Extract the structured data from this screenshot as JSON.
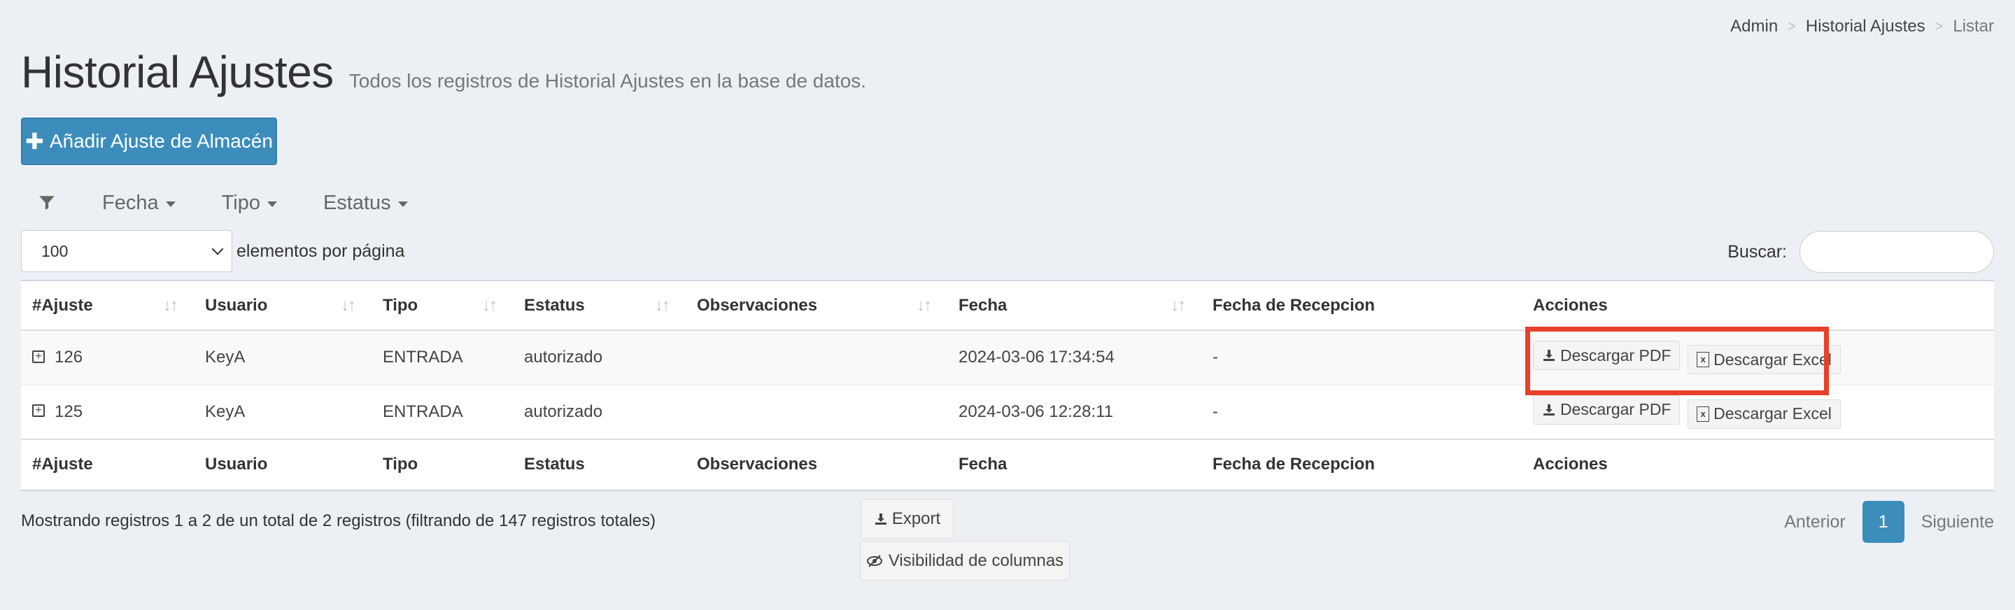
{
  "breadcrumb": {
    "items": [
      "Admin",
      "Historial Ajustes",
      "Listar"
    ],
    "separator": ">"
  },
  "header": {
    "title": "Historial Ajustes",
    "subtitle": "Todos los registros de Historial Ajustes en la base de datos."
  },
  "add_button": {
    "label": "Añadir Ajuste de Almacén",
    "icon": "plus-icon"
  },
  "filters": {
    "icon": "filter-icon",
    "items": [
      "Fecha",
      "Tipo",
      "Estatus"
    ]
  },
  "length": {
    "value": "100",
    "label": "elementos por página"
  },
  "search": {
    "label": "Buscar:",
    "placeholder": ""
  },
  "table": {
    "columns": [
      "#Ajuste",
      "Usuario",
      "Tipo",
      "Estatus",
      "Observaciones",
      "Fecha",
      "Fecha de Recepcion",
      "Acciones"
    ],
    "rows": [
      {
        "id": "126",
        "usuario": "KeyA",
        "tipo": "ENTRADA",
        "estatus": "autorizado",
        "observaciones": "",
        "fecha": "2024-03-06 17:34:54",
        "fecha_recepcion": "-"
      },
      {
        "id": "125",
        "usuario": "KeyA",
        "tipo": "ENTRADA",
        "estatus": "autorizado",
        "observaciones": "",
        "fecha": "2024-03-06 12:28:11",
        "fecha_recepcion": "-"
      }
    ],
    "actions": {
      "pdf": "Descargar PDF",
      "excel": "Descargar Excel"
    }
  },
  "footer": {
    "info": "Mostrando registros 1 a 2 de un total de 2 registros (filtrando de 147 registros totales)",
    "export_label": "Export",
    "colvis_label": "Visibilidad de columnas"
  },
  "pagination": {
    "prev": "Anterior",
    "current": "1",
    "next": "Siguiente"
  },
  "colors": {
    "primary": "#3c8dbc",
    "highlight": "#e8402a",
    "background": "#ecf0f5"
  }
}
